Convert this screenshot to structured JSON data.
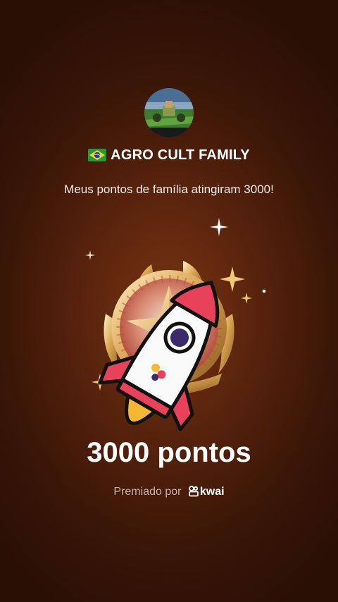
{
  "header": {
    "family_name": "AGRO CULT FAMILY",
    "flag_icon": "brazil-flag-icon",
    "avatar_icon": "family-avatar-farm-image"
  },
  "message": "Meus pontos de família atingiram 3000!",
  "achievement": {
    "points_label": "3000 pontos",
    "badge_icon": "star-medal-icon",
    "rocket_icon": "rocket-icon"
  },
  "footer": {
    "awarded_by": "Premiado por",
    "brand": "kwai"
  },
  "colors": {
    "background": "#5a240d",
    "gold": "#e0b66a",
    "rocket_red": "#e8425a"
  }
}
